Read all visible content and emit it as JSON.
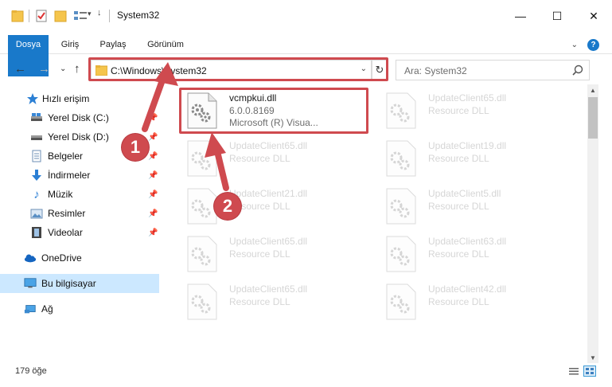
{
  "window": {
    "title": "System32",
    "minimize_glyph": "—",
    "maximize_glyph": "☐",
    "close_glyph": "✕"
  },
  "ribbon": {
    "tabs": [
      "Dosya",
      "Giriş",
      "Paylaş",
      "Görünüm"
    ],
    "help_glyph": "?",
    "accent_color": "#1979ca"
  },
  "address": {
    "path": "C:\\Windows\\System32",
    "search_placeholder": "Ara: System32"
  },
  "sidebar": {
    "items": [
      {
        "label": "Hızlı erişim",
        "icon": "star-icon"
      },
      {
        "label": "Yerel Disk (C:)",
        "icon": "disk-icon"
      },
      {
        "label": "Yerel Disk (D:)",
        "icon": "disk-icon"
      },
      {
        "label": "Belgeler",
        "icon": "documents-icon"
      },
      {
        "label": "İndirmeler",
        "icon": "download-icon"
      },
      {
        "label": "Müzik",
        "icon": "music-icon"
      },
      {
        "label": "Resimler",
        "icon": "pictures-icon"
      },
      {
        "label": "Videolar",
        "icon": "video-icon"
      },
      {
        "label": "OneDrive",
        "icon": "cloud-icon"
      },
      {
        "label": "Bu bilgisayar",
        "icon": "computer-icon"
      },
      {
        "label": "Ağ",
        "icon": "network-icon"
      }
    ]
  },
  "files": [
    {
      "name": "vcmpkui.dll",
      "version": "6.0.0.8169",
      "description": "Microsoft (R) Visua..."
    },
    {
      "name": "UpdateClient65.dll",
      "type": "Resource DLL"
    },
    {
      "name": "UpdateClient65.dll",
      "type": "Resource DLL"
    },
    {
      "name": "UpdateClient19.dll",
      "type": "Resource DLL"
    },
    {
      "name": "UpdateClient21.dll",
      "type": "Resource DLL"
    },
    {
      "name": "UpdateClient5.dll",
      "type": "Resource DLL"
    },
    {
      "name": "UpdateClient65.dll",
      "type": "Resource DLL"
    },
    {
      "name": "UpdateClient63.dll",
      "type": "Resource DLL"
    },
    {
      "name": "UpdateClient65.dll",
      "type": "Resource DLL"
    },
    {
      "name": "UpdateClient42.dll",
      "type": "Resource DLL"
    }
  ],
  "status": {
    "item_count": "179 öğe"
  },
  "annotations": {
    "step1": "1",
    "step2": "2",
    "color": "#cf4a4f"
  }
}
